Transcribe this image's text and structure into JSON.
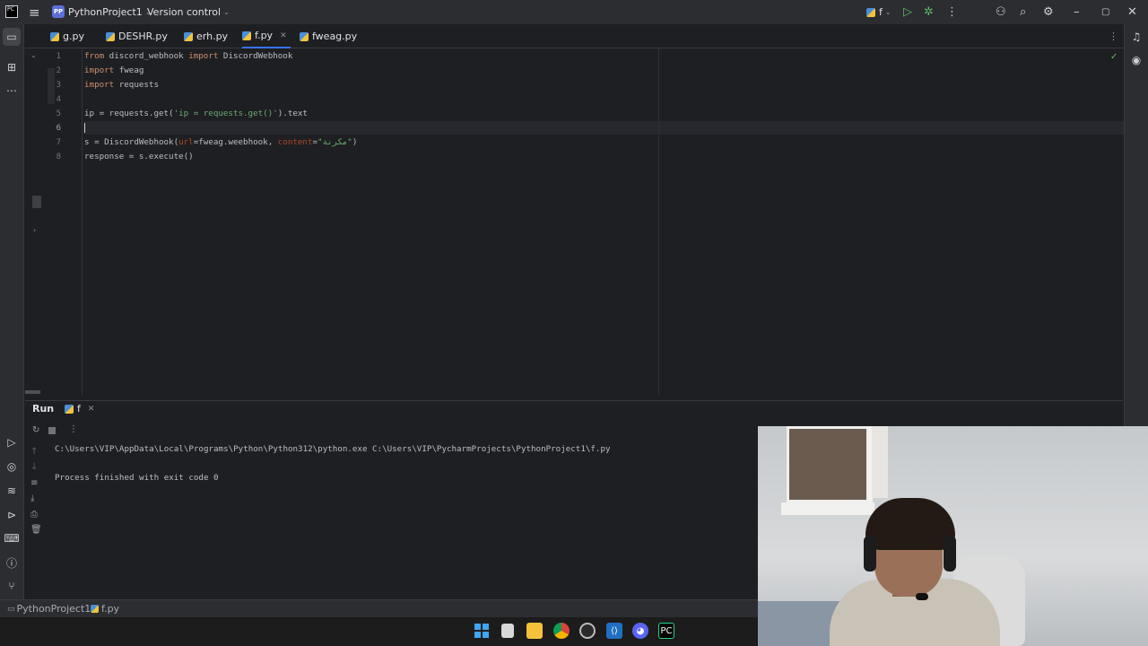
{
  "titlebar": {
    "project_badge": "PP",
    "project_name": "PythonProject1",
    "vcs_label": "Version control",
    "run_config": "f"
  },
  "tabs": [
    {
      "label": "g.py"
    },
    {
      "label": "DESHR.py"
    },
    {
      "label": "erh.py"
    },
    {
      "label": "f.py",
      "active": true
    },
    {
      "label": "fweag.py"
    }
  ],
  "editor": {
    "line_numbers": [
      "1",
      "2",
      "3",
      "4",
      "5",
      "6",
      "7",
      "8"
    ],
    "lines": {
      "l1_a": "from",
      "l1_b": " discord_webhook ",
      "l1_c": "import",
      "l1_d": " DiscordWebhook",
      "l2_a": "import",
      "l2_b": " fweag",
      "l3_a": "import",
      "l3_b": " requests",
      "l5_a": "ip = requests.get(",
      "l5_b": "'ip = requests.get()'",
      "l5_c": ").text",
      "l7_a": "s = DiscordWebhook(",
      "l7_b": "url",
      "l7_c": "=fweag.weebhook, ",
      "l7_d": "content",
      "l7_e": "=",
      "l7_f": "\"مكرنة\"",
      "l7_g": ")",
      "l8_a": "response = s.execute()"
    }
  },
  "run_panel": {
    "title": "Run",
    "tab_label": "f",
    "console_line1": "C:\\Users\\VIP\\AppData\\Local\\Programs\\Python\\Python312\\python.exe C:\\Users\\VIP\\PycharmProjects\\PythonProject1\\f.py",
    "console_line2": "Process finished with exit code 0"
  },
  "statusbar": {
    "crumb_project": "PythonProject1",
    "crumb_file": "f.py"
  },
  "taskbar": {
    "icons": [
      "windows-start-icon",
      "file-icon",
      "file-explorer-icon",
      "chrome-icon",
      "app-icon",
      "vscode-icon",
      "discord-icon",
      "pycharm-icon"
    ]
  },
  "colors": {
    "keyword": "#cf8e6d",
    "string": "#6aab73",
    "param": "#aa4926",
    "accent": "#3574f0"
  }
}
